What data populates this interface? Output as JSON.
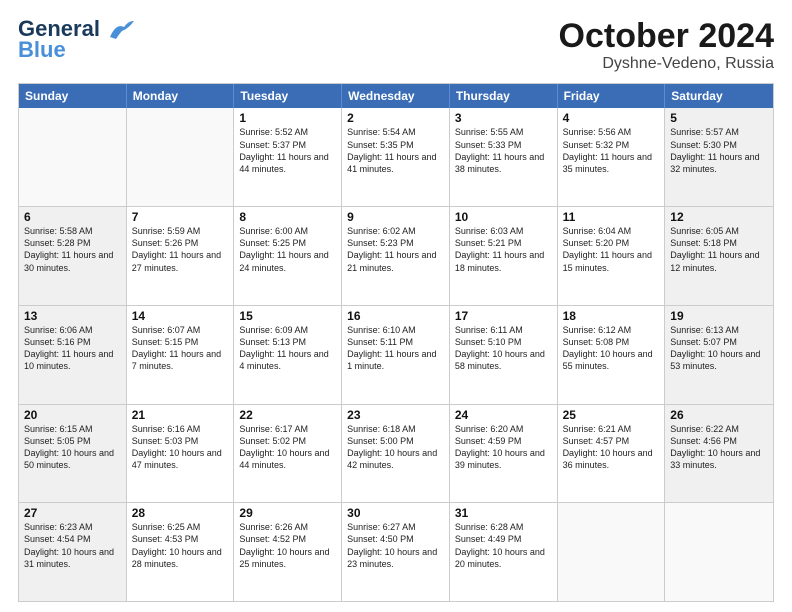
{
  "logo": {
    "line1": "General",
    "line2": "Blue"
  },
  "title": "October 2024",
  "subtitle": "Dyshne-Vedeno, Russia",
  "days": [
    "Sunday",
    "Monday",
    "Tuesday",
    "Wednesday",
    "Thursday",
    "Friday",
    "Saturday"
  ],
  "weeks": [
    [
      {
        "day": "",
        "info": ""
      },
      {
        "day": "",
        "info": ""
      },
      {
        "day": "1",
        "info": "Sunrise: 5:52 AM\nSunset: 5:37 PM\nDaylight: 11 hours and 44 minutes."
      },
      {
        "day": "2",
        "info": "Sunrise: 5:54 AM\nSunset: 5:35 PM\nDaylight: 11 hours and 41 minutes."
      },
      {
        "day": "3",
        "info": "Sunrise: 5:55 AM\nSunset: 5:33 PM\nDaylight: 11 hours and 38 minutes."
      },
      {
        "day": "4",
        "info": "Sunrise: 5:56 AM\nSunset: 5:32 PM\nDaylight: 11 hours and 35 minutes."
      },
      {
        "day": "5",
        "info": "Sunrise: 5:57 AM\nSunset: 5:30 PM\nDaylight: 11 hours and 32 minutes."
      }
    ],
    [
      {
        "day": "6",
        "info": "Sunrise: 5:58 AM\nSunset: 5:28 PM\nDaylight: 11 hours and 30 minutes."
      },
      {
        "day": "7",
        "info": "Sunrise: 5:59 AM\nSunset: 5:26 PM\nDaylight: 11 hours and 27 minutes."
      },
      {
        "day": "8",
        "info": "Sunrise: 6:00 AM\nSunset: 5:25 PM\nDaylight: 11 hours and 24 minutes."
      },
      {
        "day": "9",
        "info": "Sunrise: 6:02 AM\nSunset: 5:23 PM\nDaylight: 11 hours and 21 minutes."
      },
      {
        "day": "10",
        "info": "Sunrise: 6:03 AM\nSunset: 5:21 PM\nDaylight: 11 hours and 18 minutes."
      },
      {
        "day": "11",
        "info": "Sunrise: 6:04 AM\nSunset: 5:20 PM\nDaylight: 11 hours and 15 minutes."
      },
      {
        "day": "12",
        "info": "Sunrise: 6:05 AM\nSunset: 5:18 PM\nDaylight: 11 hours and 12 minutes."
      }
    ],
    [
      {
        "day": "13",
        "info": "Sunrise: 6:06 AM\nSunset: 5:16 PM\nDaylight: 11 hours and 10 minutes."
      },
      {
        "day": "14",
        "info": "Sunrise: 6:07 AM\nSunset: 5:15 PM\nDaylight: 11 hours and 7 minutes."
      },
      {
        "day": "15",
        "info": "Sunrise: 6:09 AM\nSunset: 5:13 PM\nDaylight: 11 hours and 4 minutes."
      },
      {
        "day": "16",
        "info": "Sunrise: 6:10 AM\nSunset: 5:11 PM\nDaylight: 11 hours and 1 minute."
      },
      {
        "day": "17",
        "info": "Sunrise: 6:11 AM\nSunset: 5:10 PM\nDaylight: 10 hours and 58 minutes."
      },
      {
        "day": "18",
        "info": "Sunrise: 6:12 AM\nSunset: 5:08 PM\nDaylight: 10 hours and 55 minutes."
      },
      {
        "day": "19",
        "info": "Sunrise: 6:13 AM\nSunset: 5:07 PM\nDaylight: 10 hours and 53 minutes."
      }
    ],
    [
      {
        "day": "20",
        "info": "Sunrise: 6:15 AM\nSunset: 5:05 PM\nDaylight: 10 hours and 50 minutes."
      },
      {
        "day": "21",
        "info": "Sunrise: 6:16 AM\nSunset: 5:03 PM\nDaylight: 10 hours and 47 minutes."
      },
      {
        "day": "22",
        "info": "Sunrise: 6:17 AM\nSunset: 5:02 PM\nDaylight: 10 hours and 44 minutes."
      },
      {
        "day": "23",
        "info": "Sunrise: 6:18 AM\nSunset: 5:00 PM\nDaylight: 10 hours and 42 minutes."
      },
      {
        "day": "24",
        "info": "Sunrise: 6:20 AM\nSunset: 4:59 PM\nDaylight: 10 hours and 39 minutes."
      },
      {
        "day": "25",
        "info": "Sunrise: 6:21 AM\nSunset: 4:57 PM\nDaylight: 10 hours and 36 minutes."
      },
      {
        "day": "26",
        "info": "Sunrise: 6:22 AM\nSunset: 4:56 PM\nDaylight: 10 hours and 33 minutes."
      }
    ],
    [
      {
        "day": "27",
        "info": "Sunrise: 6:23 AM\nSunset: 4:54 PM\nDaylight: 10 hours and 31 minutes."
      },
      {
        "day": "28",
        "info": "Sunrise: 6:25 AM\nSunset: 4:53 PM\nDaylight: 10 hours and 28 minutes."
      },
      {
        "day": "29",
        "info": "Sunrise: 6:26 AM\nSunset: 4:52 PM\nDaylight: 10 hours and 25 minutes."
      },
      {
        "day": "30",
        "info": "Sunrise: 6:27 AM\nSunset: 4:50 PM\nDaylight: 10 hours and 23 minutes."
      },
      {
        "day": "31",
        "info": "Sunrise: 6:28 AM\nSunset: 4:49 PM\nDaylight: 10 hours and 20 minutes."
      },
      {
        "day": "",
        "info": ""
      },
      {
        "day": "",
        "info": ""
      }
    ]
  ]
}
